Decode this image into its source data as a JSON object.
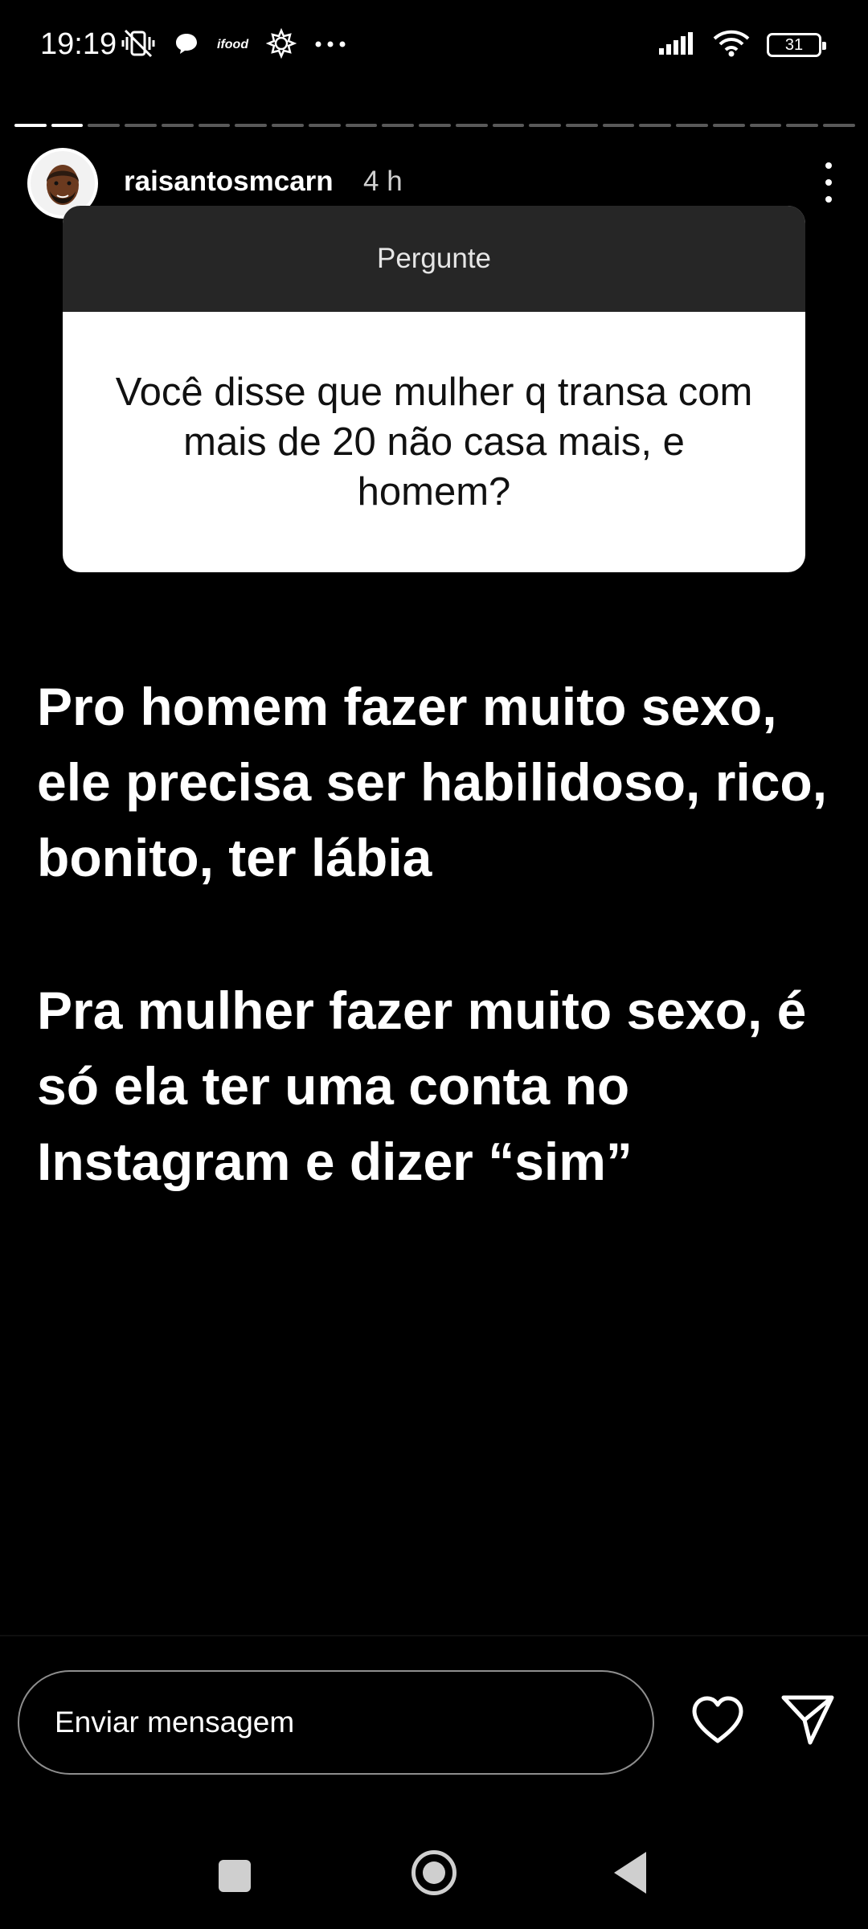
{
  "status_bar": {
    "time": "19:19",
    "left_icons": [
      "mute-vibrate-icon",
      "chat-bubble-icon",
      "ifood-icon",
      "gear-flower-icon",
      "more-notifications-icon"
    ],
    "ifood_label": "ifood",
    "battery": "31"
  },
  "story": {
    "segments_total": 23,
    "segments_done": 2,
    "username": "raisantosmcarn",
    "time_ago": "4 h"
  },
  "question_card": {
    "title": "Pergunte",
    "question": "Você disse que mulher q transa com mais de 20 não casa mais, e homem?"
  },
  "answer": {
    "paragraph1": "Pro homem fazer muito sexo, ele precisa ser habilidoso, rico, bonito, ter lábia",
    "paragraph2": "Pra mulher fazer muito sexo, é só ela ter uma conta no Instagram e dizer “sim”"
  },
  "reply": {
    "placeholder": "Enviar mensagem"
  },
  "colors": {
    "background": "#000000",
    "card_header": "#262626",
    "card_body": "#ffffff"
  }
}
